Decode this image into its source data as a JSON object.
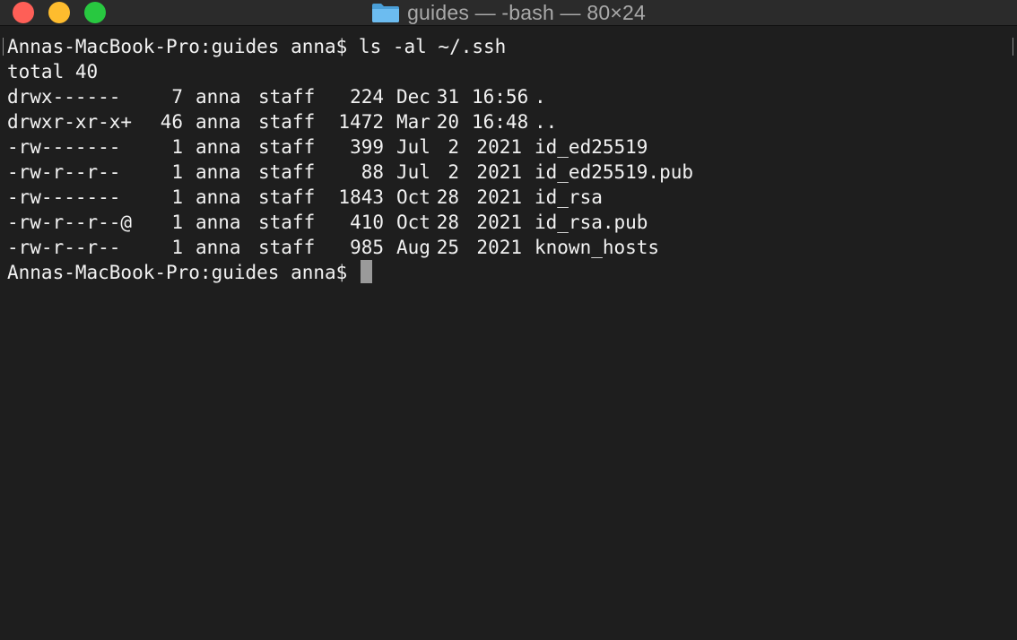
{
  "window": {
    "title": "guides — -bash — 80×24",
    "folder_icon": "folder-icon",
    "colors": {
      "background": "#1e1e1e",
      "text": "#f2f2f2",
      "close": "#fe5f57",
      "minimize": "#febc2e",
      "zoom": "#28c840",
      "folder": "#5fb3ea"
    }
  },
  "terminal": {
    "command_line": "Annas-MacBook-Pro:guides anna$ ls -al ~/.ssh",
    "total_line": "total 40",
    "entries": [
      {
        "perm": "drwx------",
        "links": "7",
        "owner": "anna",
        "group": "staff",
        "size": "224",
        "month": "Dec",
        "day": "31",
        "time": "16:56",
        "name": "."
      },
      {
        "perm": "drwxr-xr-x+",
        "links": "46",
        "owner": "anna",
        "group": "staff",
        "size": "1472",
        "month": "Mar",
        "day": "20",
        "time": "16:48",
        "name": ".."
      },
      {
        "perm": "-rw-------",
        "links": "1",
        "owner": "anna",
        "group": "staff",
        "size": "399",
        "month": "Jul",
        "day": "2",
        "time": "2021",
        "name": "id_ed25519"
      },
      {
        "perm": "-rw-r--r--",
        "links": "1",
        "owner": "anna",
        "group": "staff",
        "size": "88",
        "month": "Jul",
        "day": "2",
        "time": "2021",
        "name": "id_ed25519.pub"
      },
      {
        "perm": "-rw-------",
        "links": "1",
        "owner": "anna",
        "group": "staff",
        "size": "1843",
        "month": "Oct",
        "day": "28",
        "time": "2021",
        "name": "id_rsa"
      },
      {
        "perm": "-rw-r--r--@",
        "links": "1",
        "owner": "anna",
        "group": "staff",
        "size": "410",
        "month": "Oct",
        "day": "28",
        "time": "2021",
        "name": "id_rsa.pub"
      },
      {
        "perm": "-rw-r--r--",
        "links": "1",
        "owner": "anna",
        "group": "staff",
        "size": "985",
        "month": "Aug",
        "day": "25",
        "time": "2021",
        "name": "known_hosts"
      }
    ],
    "prompt": "Annas-MacBook-Pro:guides anna$ "
  }
}
